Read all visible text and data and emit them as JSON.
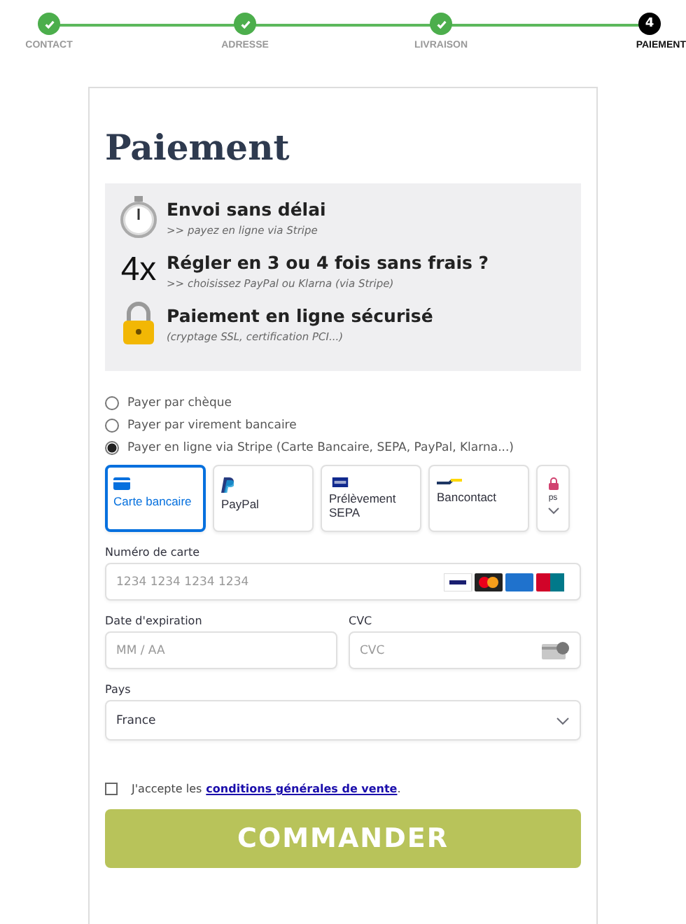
{
  "steps": [
    {
      "label": "CONTACT",
      "done": true,
      "current": false
    },
    {
      "label": "ADRESSE",
      "done": true,
      "current": false
    },
    {
      "label": "LIVRAISON",
      "done": true,
      "current": false
    },
    {
      "label": "PAIEMENT",
      "number": "4",
      "done": false,
      "current": true
    }
  ],
  "title": "Paiement",
  "benefits": [
    {
      "kind": "stopwatch",
      "title": "Envoi sans délai",
      "note": ">> payez en ligne via Stripe"
    },
    {
      "kind": "text",
      "badge": "4x",
      "title": "Régler en 3 ou 4 fois sans frais ?",
      "note": ">> choisissez PayPal ou Klarna (via Stripe)"
    },
    {
      "kind": "lock",
      "title": "Paiement en ligne sécurisé",
      "note": "(cryptage SSL, certification PCI...)"
    }
  ],
  "methods": [
    {
      "label": "Payer par chèque",
      "selected": false
    },
    {
      "label": "Payer par virement bancaire",
      "selected": false
    },
    {
      "label": "Payer en ligne via Stripe (Carte Bancaire, SEPA, PayPal, Klarna...)",
      "selected": true
    }
  ],
  "stripe_tabs": [
    {
      "kind": "card",
      "label": "Carte bancaire",
      "selected": true
    },
    {
      "kind": "paypal",
      "label": "PayPal",
      "selected": false
    },
    {
      "kind": "sepa",
      "label": "Prélèvement SEPA",
      "selected": false
    },
    {
      "kind": "bancontact",
      "label": "Bancontact",
      "selected": false
    },
    {
      "kind": "more",
      "label": "ps",
      "selected": false
    }
  ],
  "card_number": {
    "label": "Numéro de carte",
    "placeholder": "1234 1234 1234 1234"
  },
  "expiry": {
    "label": "Date d'expiration",
    "placeholder": "MM / AA"
  },
  "cvc": {
    "label": "CVC",
    "placeholder": "CVC"
  },
  "country": {
    "label": "Pays",
    "value": "France"
  },
  "terms": {
    "checked": false,
    "prefix": "J'accepte les",
    "link": "conditions générales de vente",
    "suffix": "."
  },
  "submit": "COMMANDER"
}
